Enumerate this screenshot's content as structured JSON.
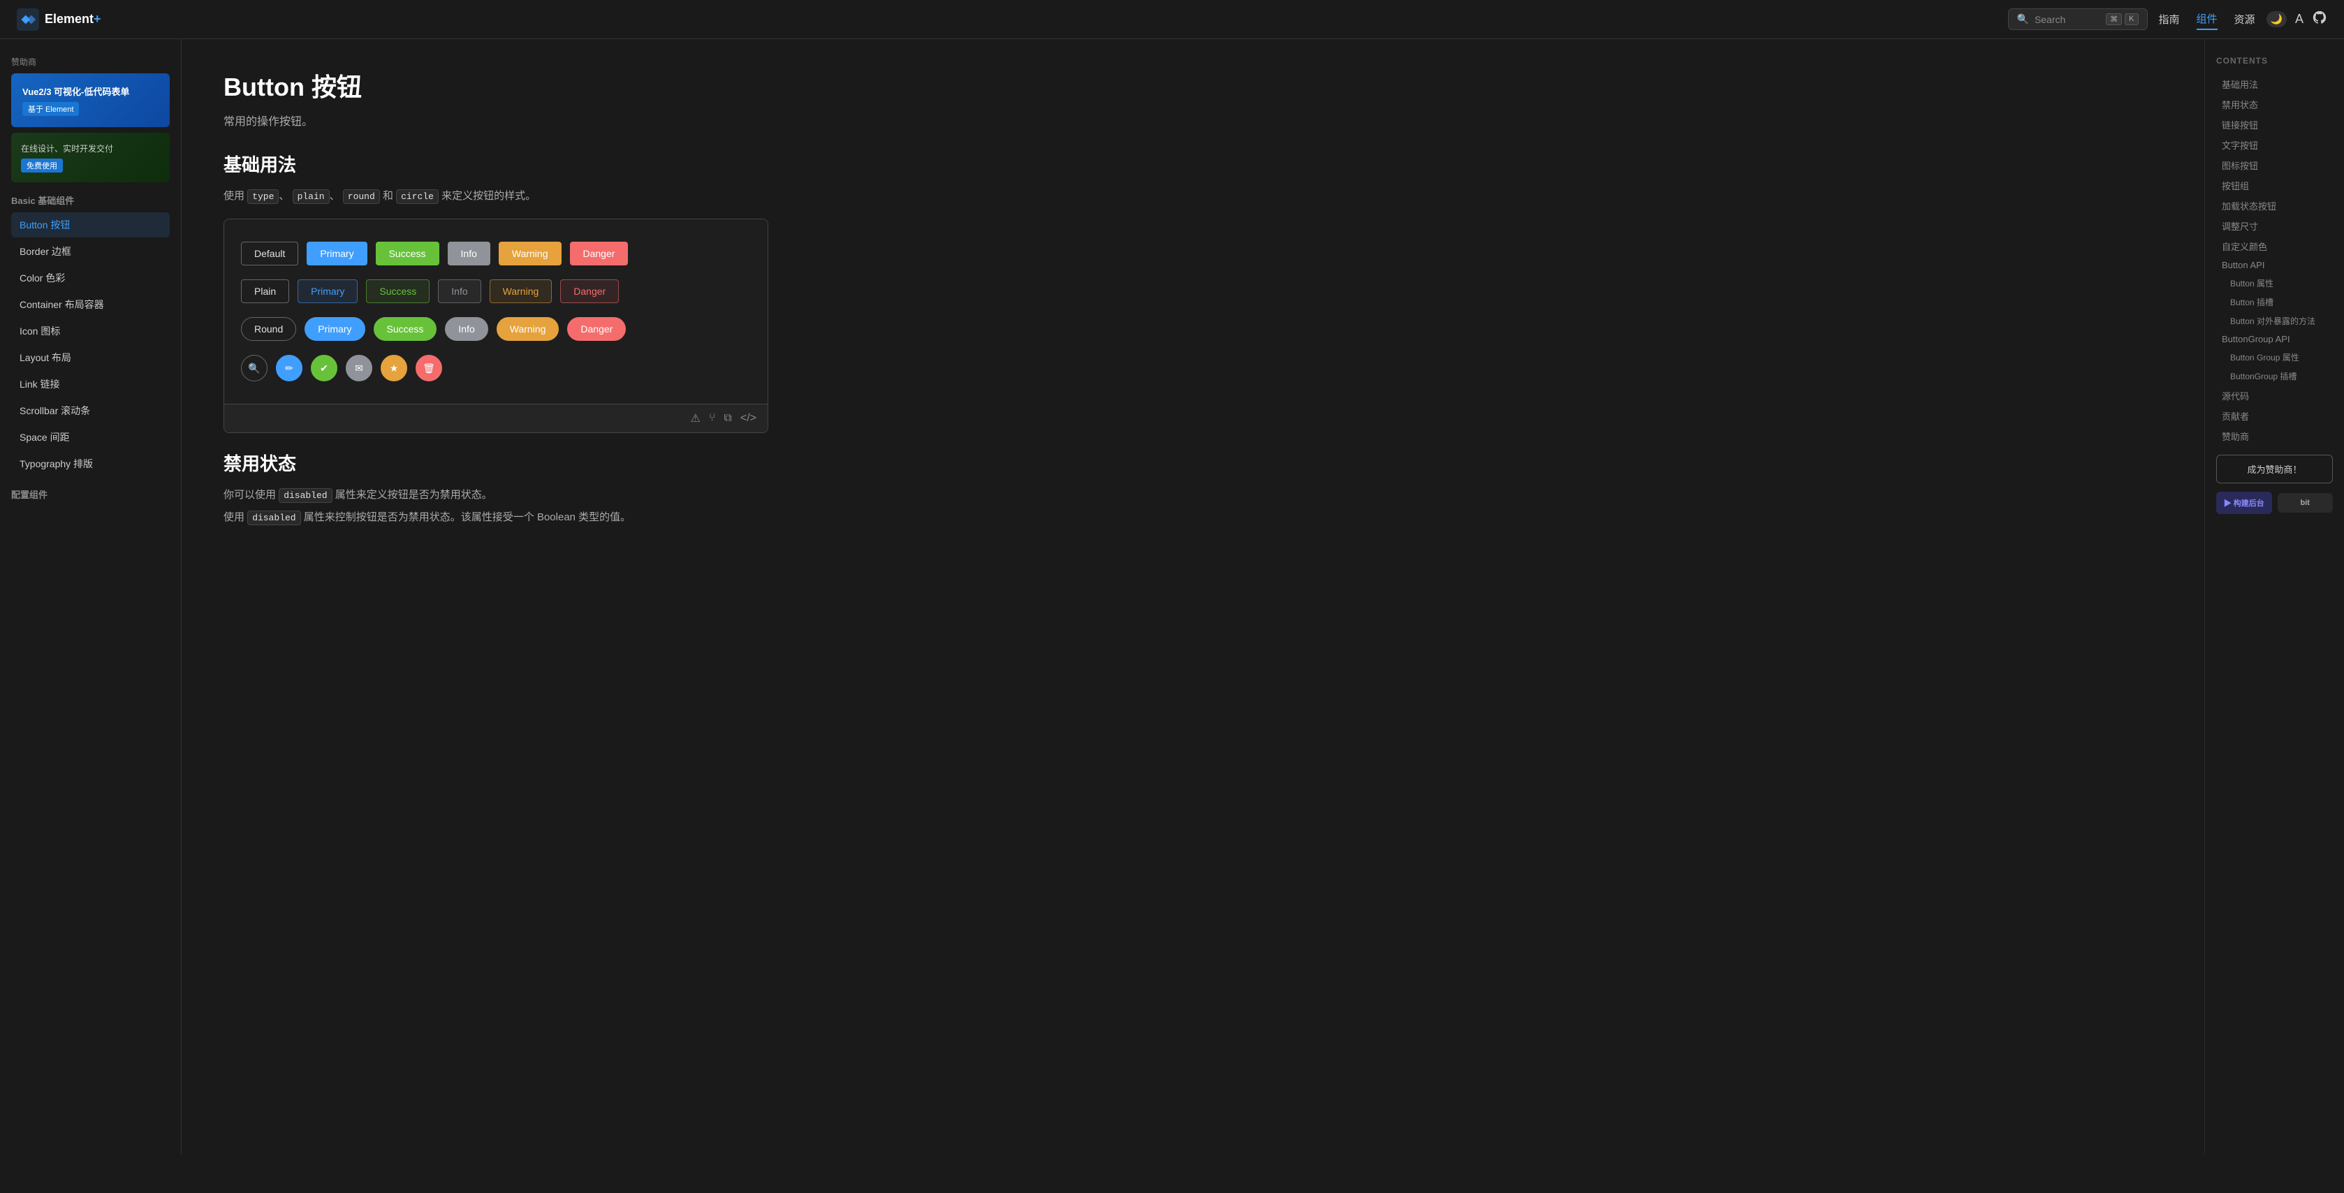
{
  "header": {
    "logo_text": "Element",
    "logo_plus": "+",
    "search_placeholder": "Search",
    "search_shortcut_1": "⌘",
    "search_shortcut_2": "K",
    "nav_links": [
      {
        "label": "指南",
        "active": false
      },
      {
        "label": "组件",
        "active": true
      },
      {
        "label": "资源",
        "active": false
      }
    ],
    "theme_icon": "🌙",
    "lang_icon": "A",
    "github_icon": "⊙"
  },
  "left_sidebar": {
    "sponsor_label": "赞助商",
    "ad1": {
      "title": "Vue2/3 可视化-低代码表单",
      "badge": "基于 Element"
    },
    "ad2": {
      "title": "在线设计、实时开发交付",
      "badge": "免费使用"
    },
    "section1": {
      "label": "Basic 基础组件"
    },
    "nav_items": [
      {
        "label": "Button 按钮",
        "active": true
      },
      {
        "label": "Border 边框",
        "active": false
      },
      {
        "label": "Color 色彩",
        "active": false
      },
      {
        "label": "Container 布局容器",
        "active": false
      },
      {
        "label": "Icon 图标",
        "active": false
      },
      {
        "label": "Layout 布局",
        "active": false
      },
      {
        "label": "Link 链接",
        "active": false
      },
      {
        "label": "Scrollbar 滚动条",
        "active": false
      },
      {
        "label": "Space 间距",
        "active": false
      },
      {
        "label": "Typography 排版",
        "active": false
      }
    ],
    "section2": {
      "label": "配置组件"
    }
  },
  "main": {
    "page_title": "Button 按钮",
    "page_subtitle": "常用的操作按钮。",
    "section1_title": "基础用法",
    "section1_desc_prefix": "使用",
    "section1_desc_codes": [
      "type",
      "plain",
      "round",
      "circle"
    ],
    "section1_desc_suffix": "来定义按钮的样式。",
    "buttons_row1": [
      {
        "label": "Default",
        "type": "default"
      },
      {
        "label": "Primary",
        "type": "primary"
      },
      {
        "label": "Success",
        "type": "success"
      },
      {
        "label": "Info",
        "type": "info"
      },
      {
        "label": "Warning",
        "type": "warning"
      },
      {
        "label": "Danger",
        "type": "danger"
      }
    ],
    "buttons_row2": [
      {
        "label": "Plain",
        "type": "plain-default"
      },
      {
        "label": "Primary",
        "type": "plain-primary"
      },
      {
        "label": "Success",
        "type": "plain-success"
      },
      {
        "label": "Info",
        "type": "plain-info"
      },
      {
        "label": "Warning",
        "type": "plain-warning"
      },
      {
        "label": "Danger",
        "type": "plain-danger"
      }
    ],
    "buttons_row3": [
      {
        "label": "Round",
        "type": "round-default"
      },
      {
        "label": "Primary",
        "type": "round-primary"
      },
      {
        "label": "Success",
        "type": "round-success"
      },
      {
        "label": "Info",
        "type": "round-info"
      },
      {
        "label": "Warning",
        "type": "round-warning"
      },
      {
        "label": "Danger",
        "type": "round-danger"
      }
    ],
    "buttons_row4": [
      {
        "icon": "🔍",
        "type": "circle-default"
      },
      {
        "icon": "✏️",
        "type": "circle-primary"
      },
      {
        "icon": "✔",
        "type": "circle-success"
      },
      {
        "icon": "✉",
        "type": "circle-info"
      },
      {
        "icon": "★",
        "type": "circle-warning"
      },
      {
        "icon": "🗑",
        "type": "circle-danger"
      }
    ],
    "section2_title": "禁用状态",
    "section2_subtitle": "你可以使用",
    "section2_code": "disabled",
    "section2_desc2": "属性来定义按钮是否为禁用状态。",
    "section2_desc3_prefix": "使用",
    "section2_desc3_code": "disabled",
    "section2_desc3_suffix": "属性来控制按钮是否为禁用状态。该属性接受一个 Boolean 类型的值。"
  },
  "right_sidebar": {
    "contents_label": "CONTENTS",
    "toc_items": [
      {
        "label": "基础用法",
        "sub": false
      },
      {
        "label": "禁用状态",
        "sub": false
      },
      {
        "label": "链接按钮",
        "sub": false
      },
      {
        "label": "文字按钮",
        "sub": false
      },
      {
        "label": "图标按钮",
        "sub": false
      },
      {
        "label": "按钮组",
        "sub": false
      },
      {
        "label": "加载状态按钮",
        "sub": false
      },
      {
        "label": "调整尺寸",
        "sub": false
      },
      {
        "label": "自定义颜色",
        "sub": false
      },
      {
        "label": "Button API",
        "sub": false
      },
      {
        "label": "Button 属性",
        "sub": true
      },
      {
        "label": "Button 插槽",
        "sub": true
      },
      {
        "label": "Button 对外暴露的方法",
        "sub": true
      },
      {
        "label": "ButtonGroup API",
        "sub": false
      },
      {
        "label": "Button Group 属性",
        "sub": true
      },
      {
        "label": "ButtonGroup 插槽",
        "sub": true
      },
      {
        "label": "源代码",
        "sub": false
      },
      {
        "label": "贡献者",
        "sub": false
      },
      {
        "label": "赞助商",
        "sub": false
      }
    ],
    "sponsor_btn_label": "成为赞助商！",
    "sponsor_logo1": "▶ 构建后台",
    "sponsor_logo2": "bit"
  }
}
